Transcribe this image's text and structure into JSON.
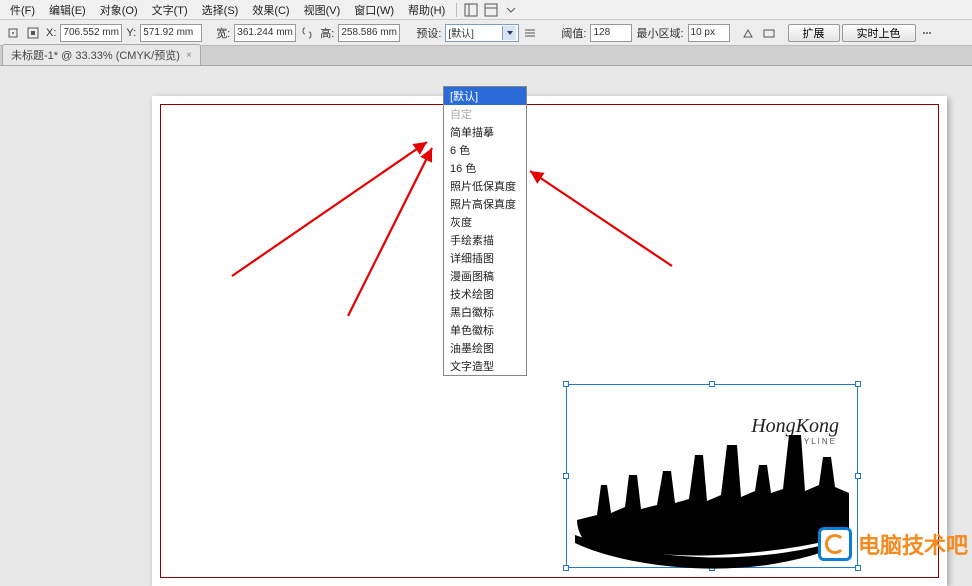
{
  "menu": {
    "file": "件(F)",
    "edit": "编辑(E)",
    "object": "对象(O)",
    "text": "文字(T)",
    "select": "选择(S)",
    "effect": "效果(C)",
    "view": "视图(V)",
    "window": "窗口(W)",
    "help": "帮助(H)"
  },
  "toolbar": {
    "x_label": "X:",
    "x_value": "706.552 mm",
    "y_label": "Y:",
    "y_value": "571.92 mm",
    "w_label": "宽:",
    "w_value": "361.244 mm",
    "h_label": "高:",
    "h_value": "258.586 mm",
    "preset_label": "预设:",
    "preset_value": "[默认]",
    "threshold_label": "阈值:",
    "threshold_value": "128",
    "minarea_label": "最小区域:",
    "minarea_value": "10 px",
    "expand_btn": "扩展",
    "live_btn": "实时上色"
  },
  "tab": {
    "title": "未标题-1* @ 33.33% (CMYK/预览)"
  },
  "dropdown": {
    "options": [
      "[默认]",
      "自定",
      "简单描摹",
      "6 色",
      "16 色",
      "照片低保真度",
      "照片高保真度",
      "灰度",
      "手绘素描",
      "详细插图",
      "漫画图稿",
      "技术绘图",
      "黑白徽标",
      "单色徽标",
      "油墨绘图",
      "文字造型"
    ]
  },
  "artwork": {
    "title": "HongKong",
    "subtitle": "SKYLINE"
  },
  "watermark": {
    "text": "电脑技术吧"
  }
}
